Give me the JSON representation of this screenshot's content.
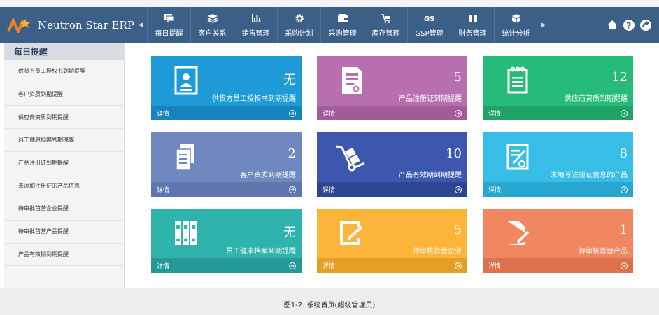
{
  "brand": {
    "name": "Neutron Star ERP"
  },
  "nav": [
    {
      "label": "每日提醒",
      "icon": "chat-icon"
    },
    {
      "label": "客户关系",
      "icon": "layers-icon"
    },
    {
      "label": "销售管理",
      "icon": "bar-chart-icon"
    },
    {
      "label": "采购计划",
      "icon": "gear-icon"
    },
    {
      "label": "采购管理",
      "icon": "wallet-icon"
    },
    {
      "label": "库存管理",
      "icon": "cart-icon"
    },
    {
      "label": "GSP管理",
      "icon": "gsp-icon"
    },
    {
      "label": "财务管理",
      "icon": "book-icon"
    },
    {
      "label": "统计分析",
      "icon": "box-icon"
    }
  ],
  "sidebar": {
    "title": "每日提醒",
    "items": [
      "供货方员工授权书到期提醒",
      "客户资质到期提醒",
      "供应商资质到期提醒",
      "员工健康档案到期提醒",
      "产品注册证到期提醒",
      "未添加注册证的产品信息",
      "待审批首营企业提醒",
      "待审批首营产品提醒",
      "产品有效期到期提醒"
    ]
  },
  "tiles": [
    {
      "count": "无",
      "label": "供货方员工授权书到期提醒",
      "detail": "详情",
      "color": "#1e9ad6",
      "bottom": "#1683bd",
      "icon": "id-card-icon"
    },
    {
      "count": "5",
      "label": "产品注册证到期提醒",
      "detail": "详情",
      "color": "#b86fb0",
      "bottom": "#a15c99",
      "icon": "certificate-icon"
    },
    {
      "count": "12",
      "label": "供应商资质到期提醒",
      "detail": "详情",
      "color": "#27bb7a",
      "bottom": "#1fa266",
      "icon": "notepad-icon"
    },
    {
      "count": "2",
      "label": "客户资质到期提醒",
      "detail": "详情",
      "color": "#7088c0",
      "bottom": "#5e76ae",
      "icon": "documents-icon"
    },
    {
      "count": "10",
      "label": "产品有效期到期提醒",
      "detail": "详情",
      "color": "#3c57ad",
      "bottom": "#2d4693",
      "icon": "hand-truck-icon"
    },
    {
      "count": "8",
      "label": "未填写注册证信息的产品",
      "detail": "详情",
      "color": "#37bde6",
      "bottom": "#26a6d0",
      "icon": "edit-doc-icon"
    },
    {
      "count": "无",
      "label": "员工健康档案到期提醒",
      "detail": "详情",
      "color": "#2fb3ad",
      "bottom": "#239a95",
      "icon": "binders-icon"
    },
    {
      "count": "5",
      "label": "待审核首营企业",
      "detail": "详情",
      "color": "#fcb43a",
      "bottom": "#e69f26",
      "icon": "edit-box-icon"
    },
    {
      "count": "1",
      "label": "待审核首营产品",
      "detail": "详情",
      "color": "#f08760",
      "bottom": "#db724d",
      "icon": "edit-file-icon"
    }
  ],
  "caption": "图1-2. 系统首页(超级管理员)"
}
